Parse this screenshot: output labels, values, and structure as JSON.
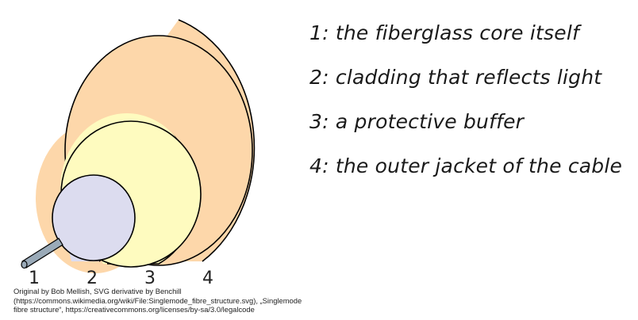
{
  "legend": [
    {
      "number": "1",
      "text": "1: the fiberglass core itself"
    },
    {
      "number": "2",
      "text": "2: cladding that reflects light"
    },
    {
      "number": "3",
      "text": "3: a protective buffer"
    },
    {
      "number": "4",
      "text": "4: the outer jacket of the cable"
    }
  ],
  "layer_numbers": [
    "1",
    "2",
    "3",
    "4"
  ],
  "credit": "Original by Bob Mellish, SVG derivative by Benchill (https://commons.wikimedia.org/wiki/File:Singlemode_fibre_structure.svg), „Singlemode fibre structure“, https://creativecommons.org/licenses/by-sa/3.0/legalcode",
  "colors": {
    "jacket": "#fdd7aa",
    "buffer": "#fefbbf",
    "cladding": "#dcdcef",
    "core": "#9aaab8",
    "outline": "#000000"
  }
}
